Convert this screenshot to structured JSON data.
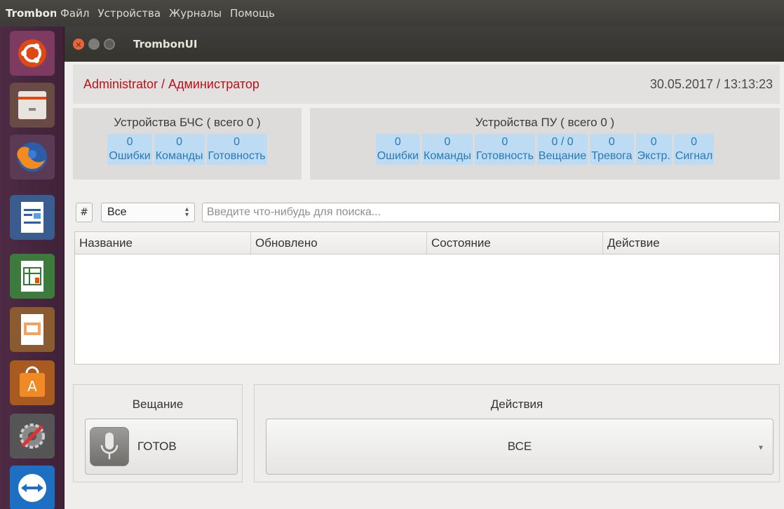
{
  "menubar": {
    "app_title": "Trombon",
    "menus": [
      "Файл",
      "Устройства",
      "Журналы",
      "Помощь"
    ]
  },
  "launcher": {
    "icons": [
      "ubuntu-dash-icon",
      "files-icon",
      "firefox-icon",
      "writer-icon",
      "calc-icon",
      "impress-icon",
      "software-center-icon",
      "system-settings-icon",
      "teamviewer-icon"
    ]
  },
  "window": {
    "title": "TrombonUI"
  },
  "header": {
    "user": "Administrator / Администратор",
    "datetime": "30.05.2017 / 13:13:23"
  },
  "panels": {
    "bhs": {
      "title": "Устройства БЧС ( всего 0 )",
      "stats": [
        {
          "value": "0",
          "label": "Ошибки"
        },
        {
          "value": "0",
          "label": "Команды"
        },
        {
          "value": "0",
          "label": "Готовность"
        }
      ]
    },
    "pu": {
      "title": "Устройства ПУ ( всего 0 )",
      "stats": [
        {
          "value": "0",
          "label": "Ошибки"
        },
        {
          "value": "0",
          "label": "Команды"
        },
        {
          "value": "0",
          "label": "Готовность"
        },
        {
          "value": "0 / 0",
          "label": "Вещание"
        },
        {
          "value": "0",
          "label": "Тревога"
        },
        {
          "value": "0",
          "label": "Экстр."
        },
        {
          "value": "0",
          "label": "Сигнал"
        }
      ]
    }
  },
  "search": {
    "hash_label": "#",
    "filter_value": "Все",
    "placeholder": "Введите что-нибудь для поиска..."
  },
  "table": {
    "columns": [
      "Название",
      "Обновлено",
      "Состояние",
      "Действие"
    ],
    "rows": []
  },
  "broadcast": {
    "title": "Вещание",
    "button_label": "ГОТОВ"
  },
  "actions": {
    "title": "Действия",
    "selected": "ВСЕ"
  },
  "colors": {
    "accent_red": "#b8121b",
    "stat_bg": "#bddcf4",
    "stat_text": "#2779b8",
    "launcher_bg": "#4d2b44"
  }
}
